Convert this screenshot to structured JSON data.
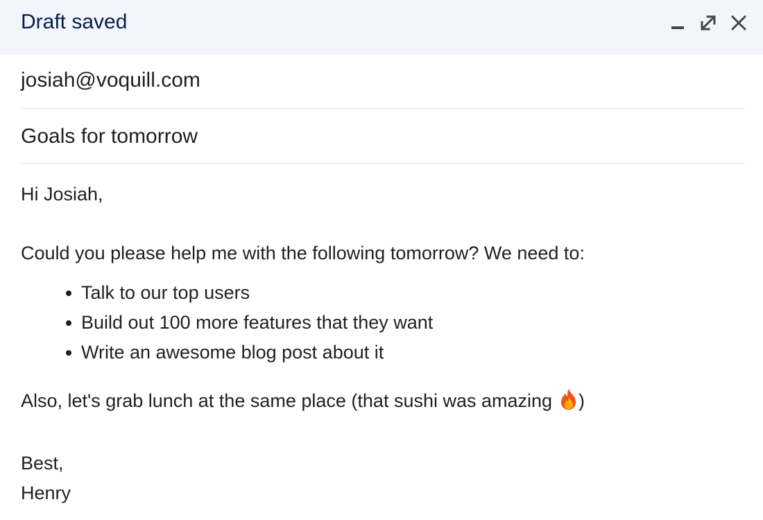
{
  "header": {
    "title": "Draft saved",
    "icons": {
      "minimize": "minimize-icon",
      "popout": "expand-icon",
      "close": "close-icon"
    }
  },
  "compose": {
    "to": "josiah@voquill.com",
    "subject": "Goals for tomorrow"
  },
  "message": {
    "greeting": "Hi Josiah,",
    "intro": "Could you please help me with the following tomorrow? We need to:",
    "items": [
      "Talk to our top users",
      "Build out 100 more features that they want",
      "Write an awesome blog post about it"
    ],
    "also_text": "Also, let's grab lunch at the same place (that sushi was amazing",
    "also_close": ")",
    "emoji_icon": "fire-emoji-icon",
    "closing": "Best,",
    "signature": "Henry"
  },
  "colors": {
    "header_bg": "#f2f6fc",
    "title": "#041e49",
    "divider": "#e3e3e3",
    "text": "#1f1f1f"
  }
}
